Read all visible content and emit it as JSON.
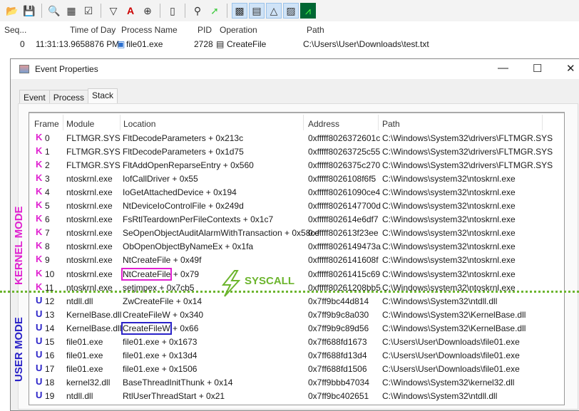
{
  "toolbar": {
    "icons": [
      "open-icon",
      "save-icon",
      "magnify-icon",
      "autoscroll-icon",
      "clear-icon",
      "filter-icon",
      "highlight-icon",
      "target-icon",
      "process-tree-icon",
      "find-icon",
      "jump-icon",
      "registry-icon",
      "filesystem-icon",
      "network-icon",
      "process-thread-icon",
      "profiling-icon"
    ]
  },
  "list": {
    "headers": {
      "seq": "Seq...",
      "time": "Time of Day",
      "process": "Process Name",
      "pid": "PID",
      "operation": "Operation",
      "path": "Path"
    },
    "row": {
      "seq": "0",
      "time": "11:31:13.9658876 PM",
      "process": "file01.exe",
      "pid": "2728",
      "operation": "CreateFile",
      "path": "C:\\Users\\User\\Downloads\\test.txt"
    }
  },
  "dialog": {
    "title": "Event Properties",
    "tabs": [
      "Event",
      "Process",
      "Stack"
    ],
    "active_tab": "Stack",
    "columns": [
      "Frame",
      "Module",
      "Location",
      "Address",
      "Path"
    ],
    "frames": [
      {
        "mode": "K",
        "frame": "0",
        "module": "FLTMGR.SYS",
        "fn": "FltDecodeParameters",
        "off": "+ 0x213c",
        "address": "0xfffff8026372601c",
        "path": "C:\\Windows\\System32\\drivers\\FLTMGR.SYS"
      },
      {
        "mode": "K",
        "frame": "1",
        "module": "FLTMGR.SYS",
        "fn": "FltDecodeParameters",
        "off": "+ 0x1d75",
        "address": "0xfffff80263725c55",
        "path": "C:\\Windows\\System32\\drivers\\FLTMGR.SYS"
      },
      {
        "mode": "K",
        "frame": "2",
        "module": "FLTMGR.SYS",
        "fn": "FltAddOpenReparseEntry",
        "off": "+ 0x560",
        "address": "0xfffff8026375c270",
        "path": "C:\\Windows\\System32\\drivers\\FLTMGR.SYS"
      },
      {
        "mode": "K",
        "frame": "3",
        "module": "ntoskrnl.exe",
        "fn": "IofCallDriver",
        "off": "+ 0x55",
        "address": "0xfffff8026108f6f5",
        "path": "C:\\Windows\\system32\\ntoskrnl.exe"
      },
      {
        "mode": "K",
        "frame": "4",
        "module": "ntoskrnl.exe",
        "fn": "IoGetAttachedDevice",
        "off": "+ 0x194",
        "address": "0xfffff80261090ce4",
        "path": "C:\\Windows\\system32\\ntoskrnl.exe"
      },
      {
        "mode": "K",
        "frame": "5",
        "module": "ntoskrnl.exe",
        "fn": "NtDeviceIoControlFile",
        "off": "+ 0x249d",
        "address": "0xfffff8026147700d",
        "path": "C:\\Windows\\system32\\ntoskrnl.exe"
      },
      {
        "mode": "K",
        "frame": "6",
        "module": "ntoskrnl.exe",
        "fn": "FsRtlTeardownPerFileContexts",
        "off": "+ 0x1c7",
        "address": "0xfffff802614e6df7",
        "path": "C:\\Windows\\system32\\ntoskrnl.exe"
      },
      {
        "mode": "K",
        "frame": "7",
        "module": "ntoskrnl.exe",
        "fn": "SeOpenObjectAuditAlarmWithTransaction",
        "off": "+ 0x58ce",
        "address": "0xfffff802613f23ee",
        "path": "C:\\Windows\\system32\\ntoskrnl.exe"
      },
      {
        "mode": "K",
        "frame": "8",
        "module": "ntoskrnl.exe",
        "fn": "ObOpenObjectByNameEx",
        "off": "+ 0x1fa",
        "address": "0xfffff8026149473a",
        "path": "C:\\Windows\\system32\\ntoskrnl.exe"
      },
      {
        "mode": "K",
        "frame": "9",
        "module": "ntoskrnl.exe",
        "fn": "NtCreateFile",
        "off": "+ 0x49f",
        "address": "0xfffff8026141608f",
        "path": "C:\\Windows\\system32\\ntoskrnl.exe"
      },
      {
        "mode": "K",
        "frame": "10",
        "module": "ntoskrnl.exe",
        "fn": "NtCreateFile",
        "off": "+ 0x79",
        "address": "0xfffff80261415c69",
        "path": "C:\\Windows\\system32\\ntoskrnl.exe",
        "highlight": "#e020d0"
      },
      {
        "mode": "K",
        "frame": "11",
        "module": "ntoskrnl.exe",
        "fn": "setjmpex",
        "off": "+ 0x7cb5",
        "address": "0xfffff80261208bb5",
        "path": "C:\\Windows\\system32\\ntoskrnl.exe"
      },
      {
        "mode": "U",
        "frame": "12",
        "module": "ntdll.dll",
        "fn": "ZwCreateFile",
        "off": "+ 0x14",
        "address": "0x7ff9bc44d814",
        "path": "C:\\Windows\\System32\\ntdll.dll"
      },
      {
        "mode": "U",
        "frame": "13",
        "module": "KernelBase.dll",
        "fn": "CreateFileW",
        "off": "+ 0x340",
        "address": "0x7ff9b9c8a030",
        "path": "C:\\Windows\\System32\\KernelBase.dll"
      },
      {
        "mode": "U",
        "frame": "14",
        "module": "KernelBase.dll",
        "fn": "CreateFileW",
        "off": "+ 0x66",
        "address": "0x7ff9b9c89d56",
        "path": "C:\\Windows\\System32\\KernelBase.dll",
        "highlight": "#2a22c8"
      },
      {
        "mode": "U",
        "frame": "15",
        "module": "file01.exe",
        "fn": "file01.exe",
        "off": "+ 0x1673",
        "address": "0x7ff688fd1673",
        "path": "C:\\Users\\User\\Downloads\\file01.exe"
      },
      {
        "mode": "U",
        "frame": "16",
        "module": "file01.exe",
        "fn": "file01.exe",
        "off": "+ 0x13d4",
        "address": "0x7ff688fd13d4",
        "path": "C:\\Users\\User\\Downloads\\file01.exe"
      },
      {
        "mode": "U",
        "frame": "17",
        "module": "file01.exe",
        "fn": "file01.exe",
        "off": "+ 0x1506",
        "address": "0x7ff688fd1506",
        "path": "C:\\Users\\User\\Downloads\\file01.exe"
      },
      {
        "mode": "U",
        "frame": "18",
        "module": "kernel32.dll",
        "fn": "BaseThreadInitThunk",
        "off": "+ 0x14",
        "address": "0x7ff9bbb47034",
        "path": "C:\\Windows\\System32\\kernel32.dll"
      },
      {
        "mode": "U",
        "frame": "19",
        "module": "ntdll.dll",
        "fn": "RtlUserThreadStart",
        "off": "+ 0x21",
        "address": "0x7ff9bc402651",
        "path": "C:\\Windows\\System32\\ntdll.dll"
      }
    ]
  },
  "annotations": {
    "kernel_label": "KERNEL MODE",
    "user_label": "USER MODE",
    "syscall_label": "SYSCALL",
    "kernel_color": "#e020d0",
    "user_color": "#2a22c8",
    "syscall_color": "#6cb52e"
  }
}
